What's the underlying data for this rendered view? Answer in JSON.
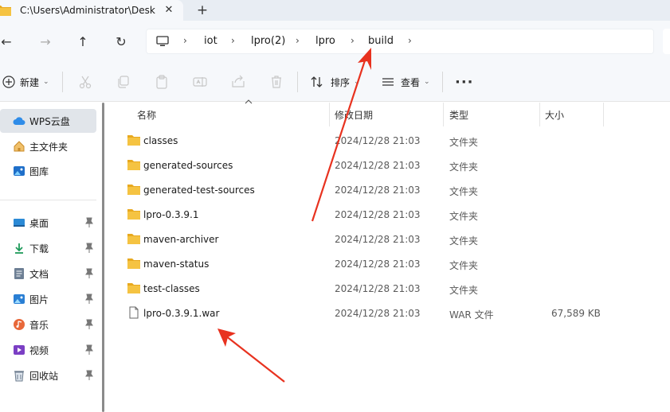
{
  "tab": {
    "title": "C:\\Users\\Administrator\\Desktop",
    "close": "✕",
    "new": "+"
  },
  "nav": {
    "back": "←",
    "forward": "→",
    "up": "↑",
    "refresh": "↻",
    "breadcrumbs": [
      "iot",
      "lpro(2)",
      "lpro",
      "build"
    ],
    "separator": "›"
  },
  "toolbar": {
    "new_label": "新建",
    "sort_label": "排序",
    "view_label": "查看",
    "caret": "⌄",
    "more": "···"
  },
  "sidebar": {
    "top": [
      {
        "label": "WPS云盘",
        "icon": "cloud-icon"
      },
      {
        "label": "主文件夹",
        "icon": "home-icon"
      },
      {
        "label": "图库",
        "icon": "gallery-icon"
      }
    ],
    "pinned": [
      {
        "label": "桌面",
        "icon": "desktop-icon"
      },
      {
        "label": "下载",
        "icon": "download-icon"
      },
      {
        "label": "文档",
        "icon": "document-icon"
      },
      {
        "label": "图片",
        "icon": "pictures-icon"
      },
      {
        "label": "音乐",
        "icon": "music-icon"
      },
      {
        "label": "视频",
        "icon": "video-icon"
      },
      {
        "label": "回收站",
        "icon": "recycle-bin-icon"
      }
    ]
  },
  "columns": {
    "name": "名称",
    "modified": "修改日期",
    "type": "类型",
    "size": "大小"
  },
  "files": [
    {
      "name": "classes",
      "modified": "2024/12/28 21:03",
      "type": "文件夹",
      "size": "",
      "kind": "folder"
    },
    {
      "name": "generated-sources",
      "modified": "2024/12/28 21:03",
      "type": "文件夹",
      "size": "",
      "kind": "folder"
    },
    {
      "name": "generated-test-sources",
      "modified": "2024/12/28 21:03",
      "type": "文件夹",
      "size": "",
      "kind": "folder"
    },
    {
      "name": "lpro-0.3.9.1",
      "modified": "2024/12/28 21:03",
      "type": "文件夹",
      "size": "",
      "kind": "folder"
    },
    {
      "name": "maven-archiver",
      "modified": "2024/12/28 21:03",
      "type": "文件夹",
      "size": "",
      "kind": "folder"
    },
    {
      "name": "maven-status",
      "modified": "2024/12/28 21:03",
      "type": "文件夹",
      "size": "",
      "kind": "folder"
    },
    {
      "name": "test-classes",
      "modified": "2024/12/28 21:03",
      "type": "文件夹",
      "size": "",
      "kind": "folder"
    },
    {
      "name": "lpro-0.3.9.1.war",
      "modified": "2024/12/28 21:03",
      "type": "WAR 文件",
      "size": "67,589 KB",
      "kind": "file"
    }
  ],
  "colors": {
    "folder": "#f5c342",
    "folder_dark": "#e8a91f",
    "accent": "#0067c0",
    "annotation_arrow": "#e8321f"
  }
}
